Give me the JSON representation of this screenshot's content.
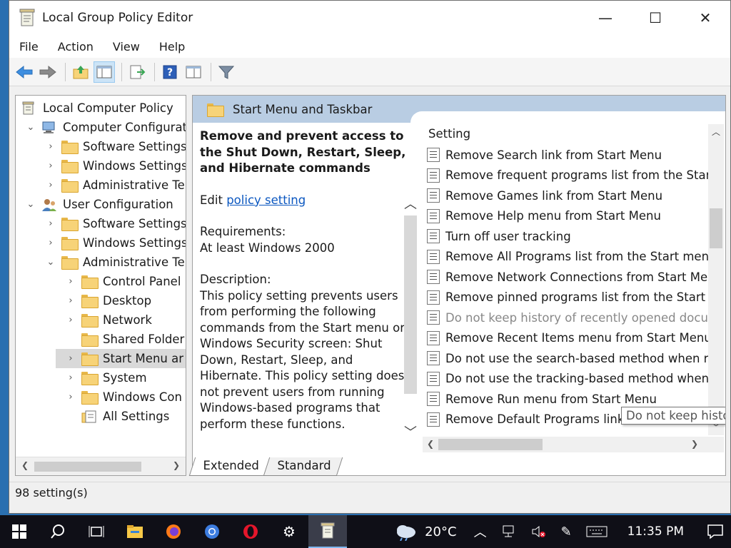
{
  "window": {
    "title": "Local Group Policy Editor",
    "controls": {
      "minimize": "—",
      "maximize": "☐",
      "close": "✕"
    }
  },
  "menu": [
    "File",
    "Action",
    "View",
    "Help"
  ],
  "tree": {
    "root": "Local Computer Policy",
    "items": [
      {
        "label": "Computer Configurat",
        "level": 1,
        "chevron": "⌄",
        "icon": "computer-icon"
      },
      {
        "label": "Software Settings",
        "level": 2,
        "chevron": "›",
        "icon": "folder-icon"
      },
      {
        "label": "Windows Settings",
        "level": 2,
        "chevron": "›",
        "icon": "folder-icon"
      },
      {
        "label": "Administrative Te",
        "level": 2,
        "chevron": "›",
        "icon": "folder-icon"
      },
      {
        "label": "User Configuration",
        "level": 1,
        "chevron": "⌄",
        "icon": "user-icon"
      },
      {
        "label": "Software Settings",
        "level": 2,
        "chevron": "›",
        "icon": "folder-icon"
      },
      {
        "label": "Windows Settings",
        "level": 2,
        "chevron": "›",
        "icon": "folder-icon"
      },
      {
        "label": "Administrative Te",
        "level": 2,
        "chevron": "⌄",
        "icon": "folder-icon"
      },
      {
        "label": "Control Panel",
        "level": 3,
        "chevron": "›",
        "icon": "folder-icon"
      },
      {
        "label": "Desktop",
        "level": 3,
        "chevron": "›",
        "icon": "folder-icon"
      },
      {
        "label": "Network",
        "level": 3,
        "chevron": "›",
        "icon": "folder-icon"
      },
      {
        "label": "Shared Folder",
        "level": 3,
        "chevron": "",
        "icon": "folder-icon"
      },
      {
        "label": "Start Menu ar",
        "level": 3,
        "chevron": "›",
        "icon": "folder-icon",
        "selected": true
      },
      {
        "label": "System",
        "level": 3,
        "chevron": "›",
        "icon": "folder-icon"
      },
      {
        "label": "Windows Con",
        "level": 3,
        "chevron": "›",
        "icon": "folder-icon"
      },
      {
        "label": "All Settings",
        "level": 3,
        "chevron": "",
        "icon": "settings-folder-icon"
      }
    ]
  },
  "panel": {
    "header": "Start Menu and Taskbar",
    "policy_title": "Remove and prevent access to the Shut Down, Restart, Sleep, and Hibernate commands",
    "edit_prefix": "Edit ",
    "edit_link": "policy setting",
    "requirements_label": "Requirements:",
    "requirements_value": "At least Windows 2000",
    "description_label": "Description:",
    "description_text": "This policy setting prevents users from performing the following commands from the Start menu or Windows Security screen: Shut Down, Restart, Sleep, and Hibernate. This policy setting does not prevent users from running Windows-based programs that perform these functions."
  },
  "settings": {
    "column": "Setting",
    "rows": [
      "Remove Search link from Start Menu",
      "Remove frequent programs list from the Start M",
      "Remove Games link from Start Menu",
      "Remove Help menu from Start Menu",
      "Turn off user tracking",
      "Remove All Programs list from the Start menu",
      "Remove Network Connections from Start Menu",
      "Remove pinned programs list from the Start Me",
      "Do not keep history of recently opened documents",
      "Remove Recent Items menu from Start Menu",
      "Do not use the search-based method when reso",
      "Do not use the tracking-based method when re",
      "Remove Run menu from Start Menu",
      "Remove Default Programs link from the Start m"
    ],
    "tooltip": "Do not keep history of recently opened documents"
  },
  "tabs": [
    "Extended",
    "Standard"
  ],
  "status": "98 setting(s)",
  "taskbar": {
    "temperature": "20°C",
    "time": "11:35 PM"
  }
}
